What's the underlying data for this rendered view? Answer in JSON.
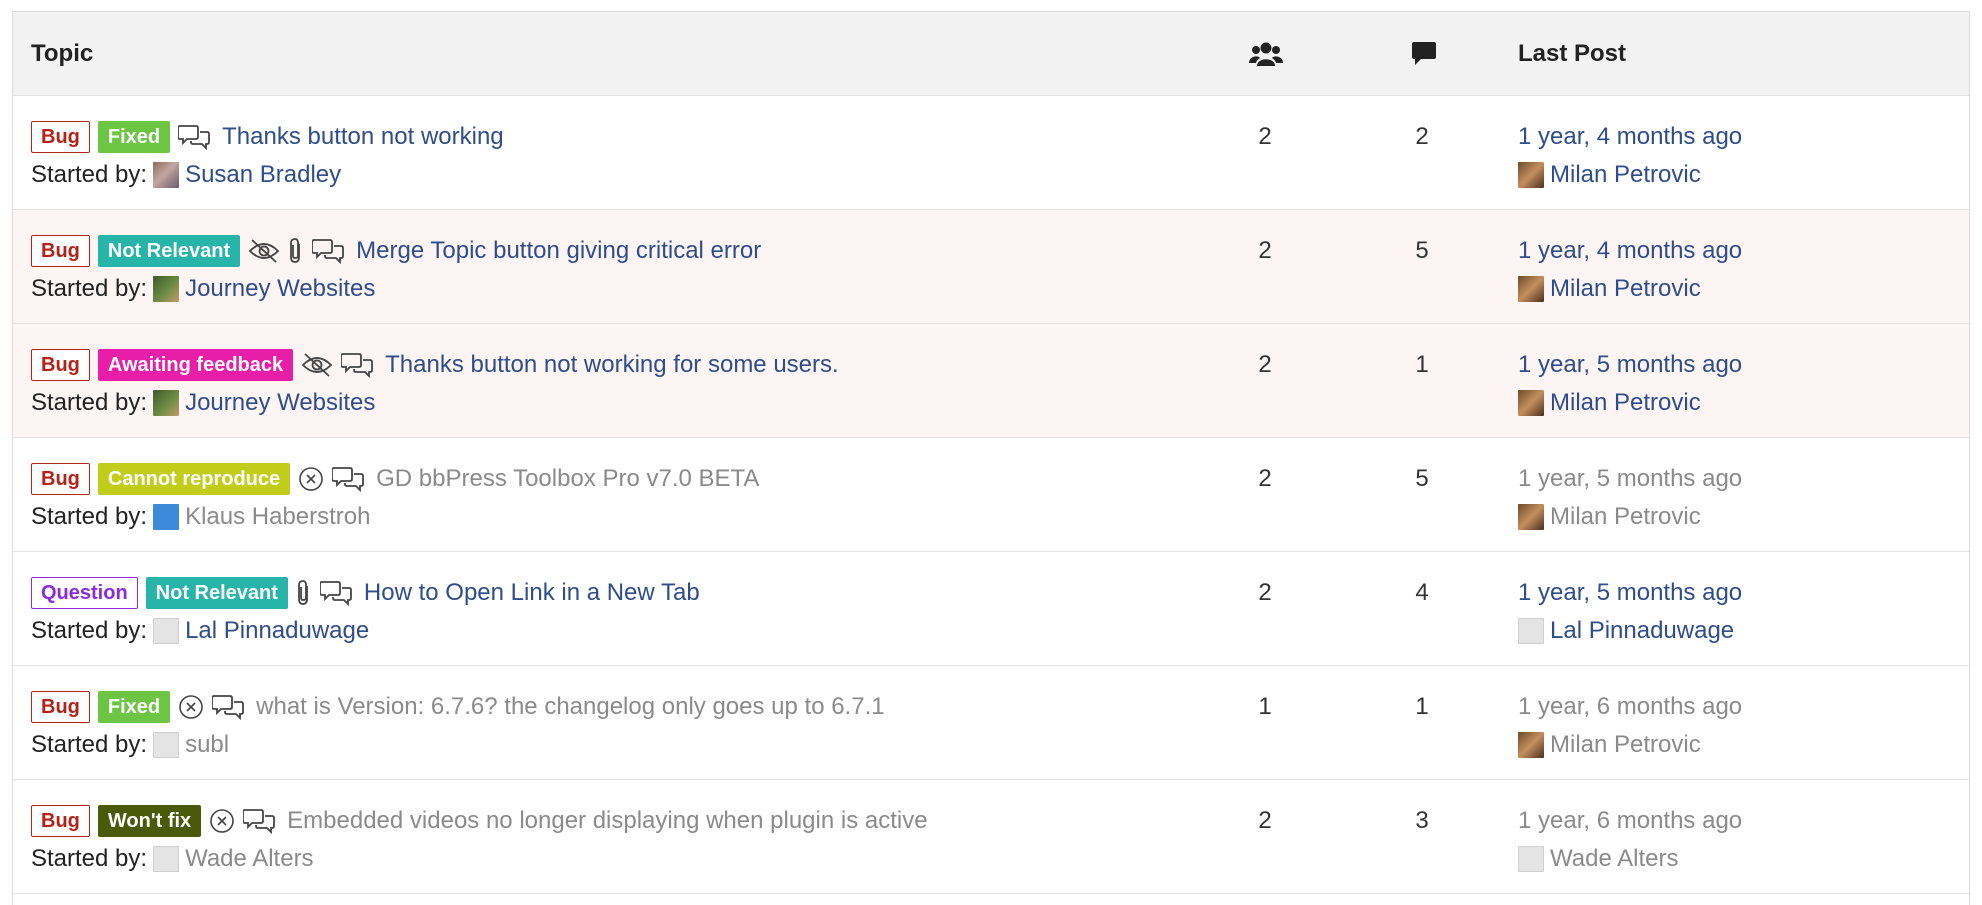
{
  "colors": {
    "link": "#2e4d8a",
    "muted": "#8a8a8a",
    "bug": "#b42318",
    "question": "#8a2be2",
    "fixed": "#6cc644",
    "not_relevant": "#26b5a8",
    "awaiting_feedback": "#e81ea9",
    "cannot_reproduce": "#c1cd18",
    "wont_fix": "#4b5a0a"
  },
  "header": {
    "topic": "Topic",
    "voices_icon": "users-icon",
    "replies_icon": "comment-icon",
    "last_post": "Last Post"
  },
  "rows": [
    {
      "type_label": "Bug",
      "status_label": "Fixed",
      "icons": [
        "discussion-icon"
      ],
      "title": "Thanks button not working",
      "started_by_label": "Started by:",
      "author": "Susan Bradley",
      "voices": "2",
      "replies": "2",
      "last_time": "1 year, 4 months ago",
      "last_author": "Milan Petrovic",
      "muted": false,
      "sticky": false
    },
    {
      "type_label": "Bug",
      "status_label": "Not Relevant",
      "icons": [
        "hidden-eye-icon",
        "paperclip-icon",
        "discussion-icon"
      ],
      "title": "Merge Topic button giving critical error",
      "started_by_label": "Started by:",
      "author": "Journey Websites",
      "voices": "2",
      "replies": "5",
      "last_time": "1 year, 4 months ago",
      "last_author": "Milan Petrovic",
      "muted": false,
      "sticky": true
    },
    {
      "type_label": "Bug",
      "status_label": "Awaiting feedback",
      "icons": [
        "hidden-eye-icon",
        "discussion-icon"
      ],
      "title": "Thanks button not working for some users.",
      "started_by_label": "Started by:",
      "author": "Journey Websites",
      "voices": "2",
      "replies": "1",
      "last_time": "1 year, 5 months ago",
      "last_author": "Milan Petrovic",
      "muted": false,
      "sticky": true
    },
    {
      "type_label": "Bug",
      "status_label": "Cannot reproduce",
      "icons": [
        "closed-circle-icon",
        "discussion-icon"
      ],
      "title": "GD bbPress Toolbox Pro v7.0 BETA",
      "started_by_label": "Started by:",
      "author": "Klaus Haberstroh",
      "voices": "2",
      "replies": "5",
      "last_time": "1 year, 5 months ago",
      "last_author": "Milan Petrovic",
      "muted": true,
      "sticky": false
    },
    {
      "type_label": "Question",
      "status_label": "Not Relevant",
      "icons": [
        "paperclip-icon",
        "discussion-icon"
      ],
      "title": "How to Open Link in a New Tab",
      "started_by_label": "Started by:",
      "author": "Lal Pinnaduwage",
      "voices": "2",
      "replies": "4",
      "last_time": "1 year, 5 months ago",
      "last_author": "Lal Pinnaduwage",
      "muted": false,
      "sticky": false
    },
    {
      "type_label": "Bug",
      "status_label": "Fixed",
      "icons": [
        "closed-circle-icon",
        "discussion-icon"
      ],
      "title": "what is Version: 6.7.6? the changelog only goes up to 6.7.1",
      "started_by_label": "Started by:",
      "author": "subl",
      "voices": "1",
      "replies": "1",
      "last_time": "1 year, 6 months ago",
      "last_author": "Milan Petrovic",
      "muted": true,
      "sticky": false
    },
    {
      "type_label": "Bug",
      "status_label": "Won't fix",
      "icons": [
        "closed-circle-icon",
        "discussion-icon"
      ],
      "title": "Embedded videos no longer displaying when plugin is active",
      "started_by_label": "Started by:",
      "author": "Wade Alters",
      "voices": "2",
      "replies": "3",
      "last_time": "1 year, 6 months ago",
      "last_author": "Wade Alters",
      "muted": true,
      "sticky": false
    }
  ]
}
